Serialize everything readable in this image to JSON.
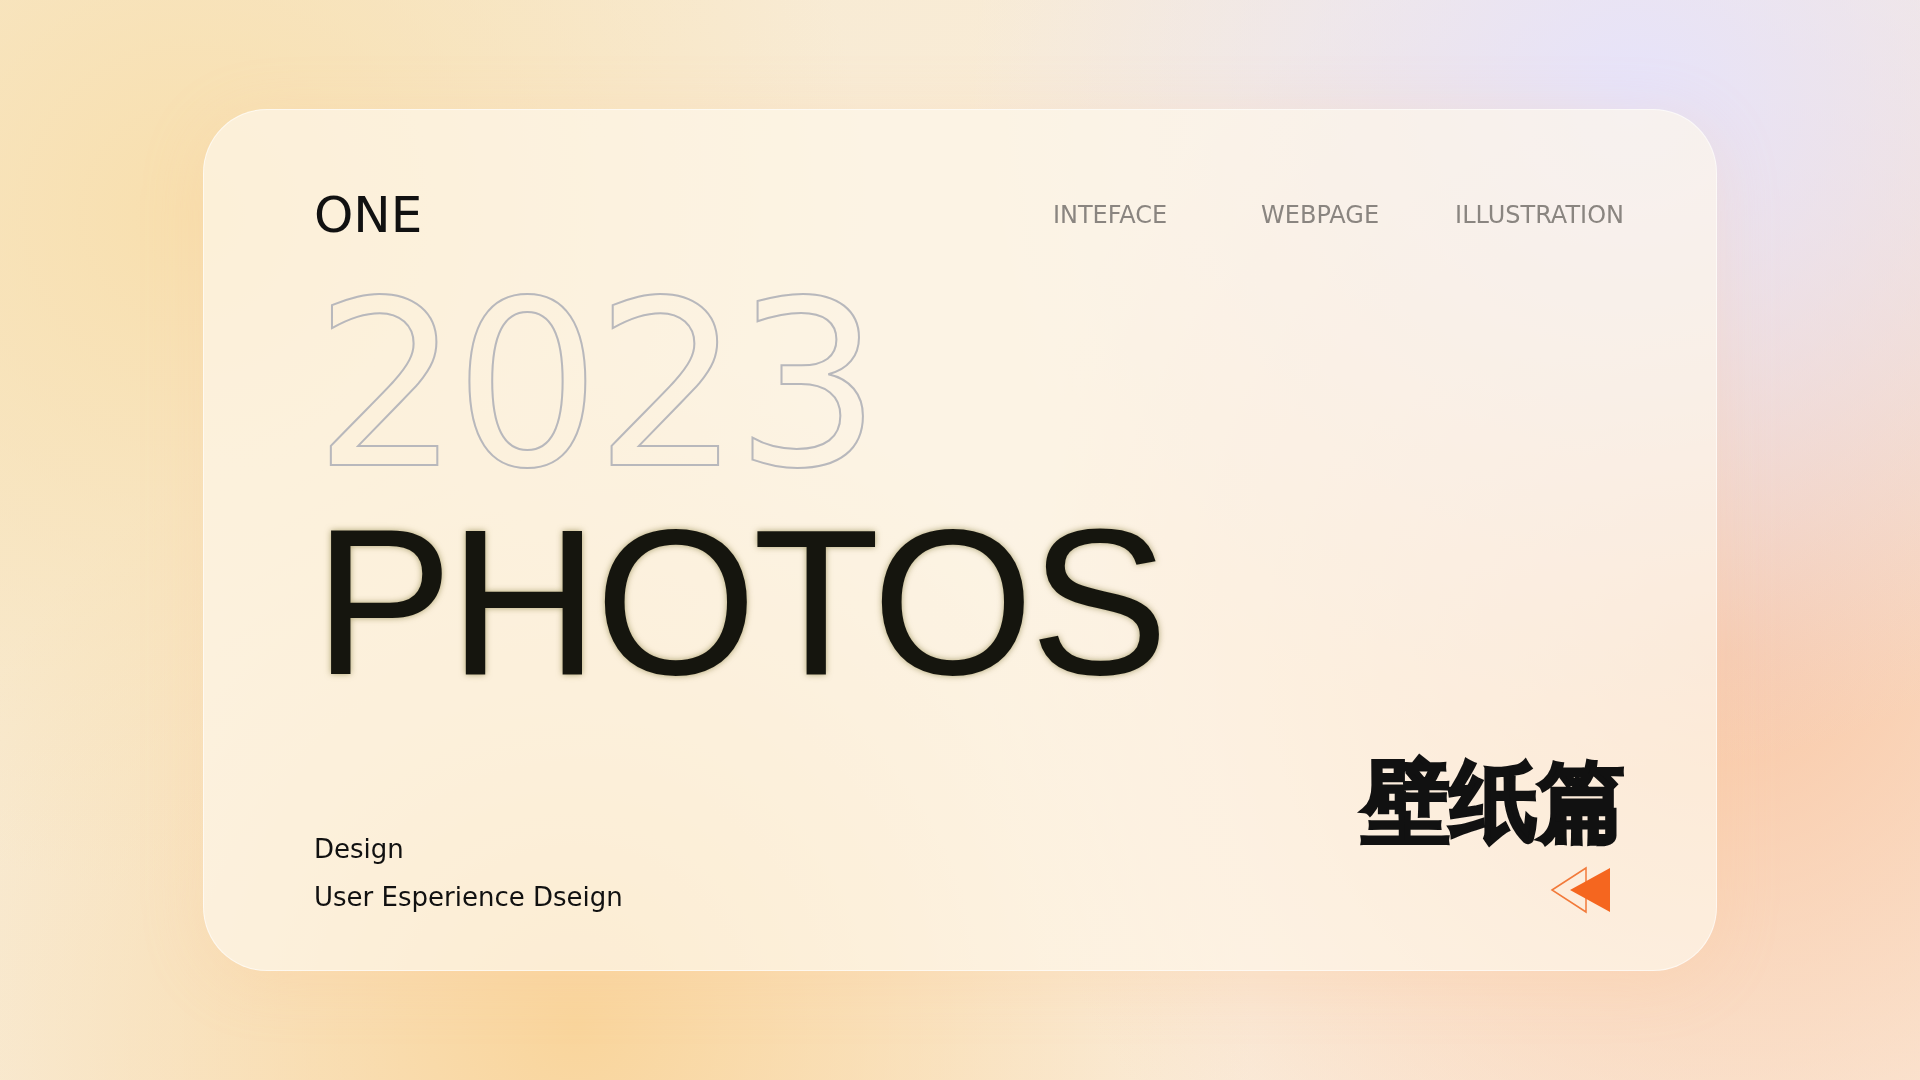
{
  "header": {
    "logo": "ONE",
    "nav": [
      {
        "label": "INTEFACE"
      },
      {
        "label": "WEBPAGE"
      },
      {
        "label": "ILLUSTRATION"
      }
    ]
  },
  "hero": {
    "year": "2023",
    "title": "PHOTOS",
    "lines": [
      "Design",
      "User Esperience Dseign"
    ],
    "chinese_title": "壁纸篇"
  }
}
